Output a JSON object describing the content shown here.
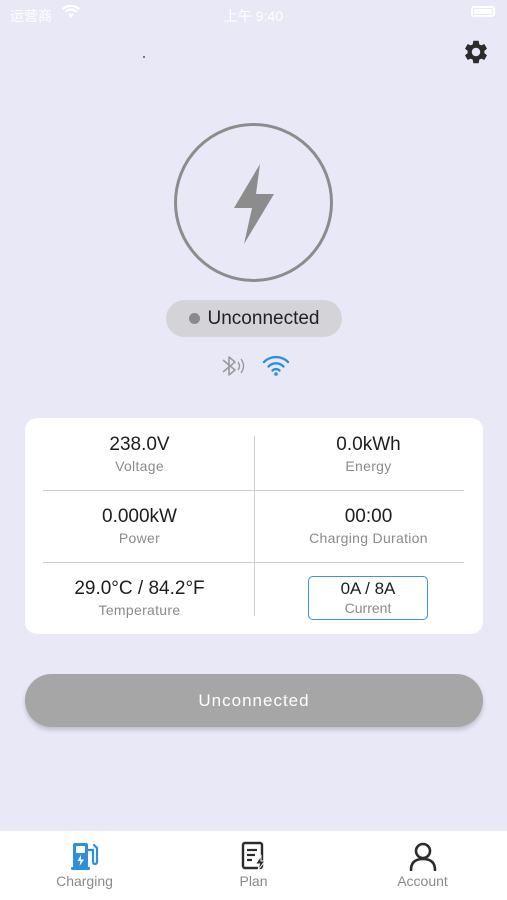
{
  "status_bar": {
    "carrier": "运营商",
    "time": "上午 9:40"
  },
  "connection": {
    "status_label": "Unconnected"
  },
  "stats": {
    "voltage": {
      "value": "238.0V",
      "label": "Voltage"
    },
    "energy": {
      "value": "0.0kWh",
      "label": "Energy"
    },
    "power": {
      "value": "0.000kW",
      "label": "Power"
    },
    "duration": {
      "value": "00:00",
      "label": "Charging Duration"
    },
    "temperature": {
      "value": "29.0°C / 84.2°F",
      "label": "Temperature"
    },
    "current": {
      "value": "0A / 8A",
      "label": "Current"
    }
  },
  "action_button": {
    "label": "Unconnected"
  },
  "tabs": [
    {
      "label": "Charging",
      "icon": "charging-station-icon",
      "active": true
    },
    {
      "label": "Plan",
      "icon": "plan-icon",
      "active": false
    },
    {
      "label": "Account",
      "icon": "account-icon",
      "active": false
    }
  ],
  "colors": {
    "background": "#e9e8f7",
    "accent": "#2f8fd8",
    "button_disabled": "#a6a6a6",
    "current_border": "#3b96d4"
  }
}
